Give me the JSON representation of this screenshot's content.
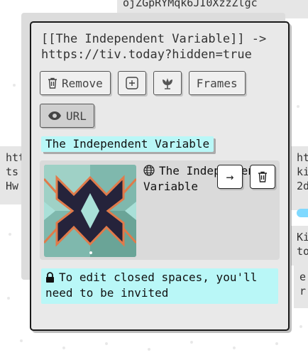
{
  "background": {
    "top_card_text": "ojZGpRYMqk6JI0XzzZlgc",
    "left_card_lines": [
      "htt",
      "ts",
      "Hw"
    ],
    "right_card_lines": [
      "ht",
      "ki",
      "2d"
    ],
    "right_card2_lines": [
      "Ki",
      "to"
    ],
    "right_card3_lines": [
      "e",
      "r"
    ]
  },
  "dialog": {
    "title": "[[The Independent Variable]] -> https://tiv.today?hidden=true",
    "buttons": {
      "remove_label": "Remove",
      "frames_label": "Frames",
      "url_label": "URL"
    },
    "tag_label": "The Independent Variable",
    "space_card": {
      "name": "The Independent Variable",
      "go_label": "→"
    },
    "notice_text": "To edit closed spaces, you'll need to be invited"
  },
  "colors": {
    "tag_bg": "#b9f7f7",
    "dialog_bg": "#e9e9e9",
    "card_bg": "#dadada"
  }
}
